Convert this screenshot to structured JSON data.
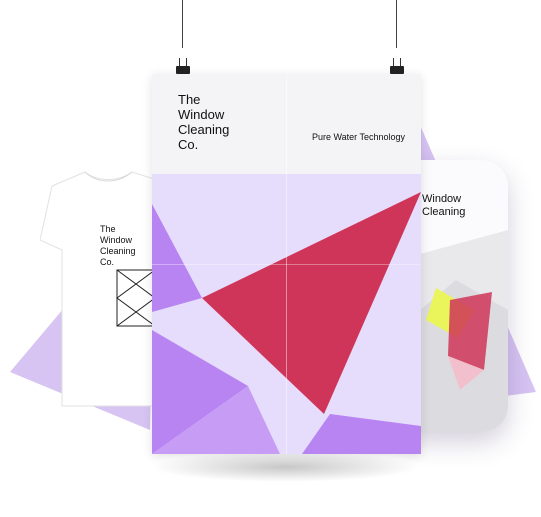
{
  "brand": {
    "name_lines": [
      "The",
      "Window",
      "Cleaning",
      "Co."
    ],
    "tagline": "Pure Water Technology"
  },
  "colors": {
    "lavender": "#c9b0ef",
    "light_lavender": "#e6dcfb",
    "purple": "#b784f2",
    "crimson": "#cf3558",
    "paper": "#f4f4f6",
    "ink": "#111111"
  },
  "icons": {
    "clip": "binder-clip-icon",
    "shirt_logo": "geometric-logo-icon"
  }
}
